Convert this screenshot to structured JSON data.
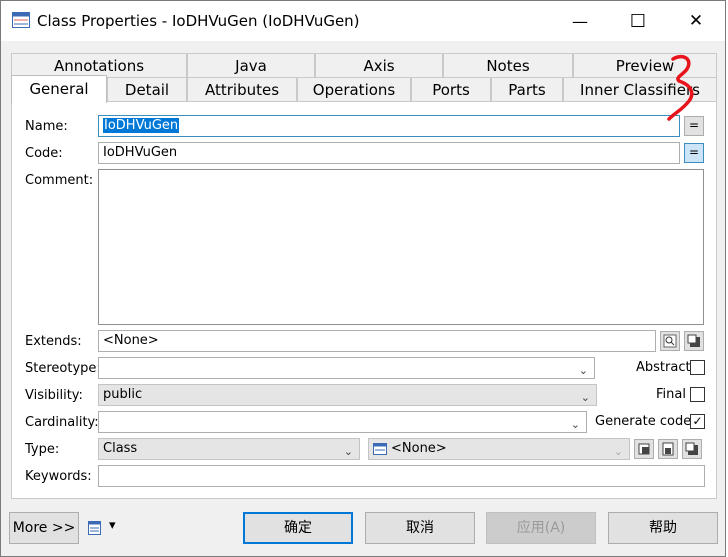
{
  "window": {
    "title": "Class Properties - IoDHVuGen (IoDHVuGen)",
    "icon": "class-icon",
    "controls": {
      "minimize": "—",
      "maximize": "☐",
      "close": "✕"
    }
  },
  "tabs": {
    "row1": [
      "Annotations",
      "Java",
      "Axis",
      "Notes",
      "Preview"
    ],
    "row2": [
      "General",
      "Detail",
      "Attributes",
      "Operations",
      "Ports",
      "Parts",
      "Inner Classifiers"
    ],
    "active": "General"
  },
  "general": {
    "name_label": "Name:",
    "name_value": "IoDHVuGen",
    "name_eq": "=",
    "code_label": "Code:",
    "code_value": "IoDHVuGen",
    "code_eq": "=",
    "comment_label": "Comment:",
    "comment_value": "",
    "extends_label": "Extends:",
    "extends_value": "<None>",
    "stereotype_label": "Stereotype:",
    "stereotype_value": "",
    "visibility_label": "Visibility:",
    "visibility_value": "public",
    "cardinality_label": "Cardinality:",
    "cardinality_value": "",
    "type_label": "Type:",
    "type_value": "Class",
    "type_related_value": "<None>",
    "keywords_label": "Keywords:",
    "keywords_value": "",
    "abstract_label": "Abstract",
    "abstract_checked": false,
    "final_label": "Final",
    "final_checked": false,
    "generate_label": "Generate code",
    "generate_checked": true,
    "check_glyph": "✓"
  },
  "footer": {
    "more_label": "More >>",
    "ok_label": "确定",
    "cancel_label": "取消",
    "apply_label": "应用(A)",
    "help_label": "帮助",
    "menu_caret": "▾"
  },
  "colors": {
    "accent": "#0078d7",
    "annotation_red": "#e8141c"
  }
}
